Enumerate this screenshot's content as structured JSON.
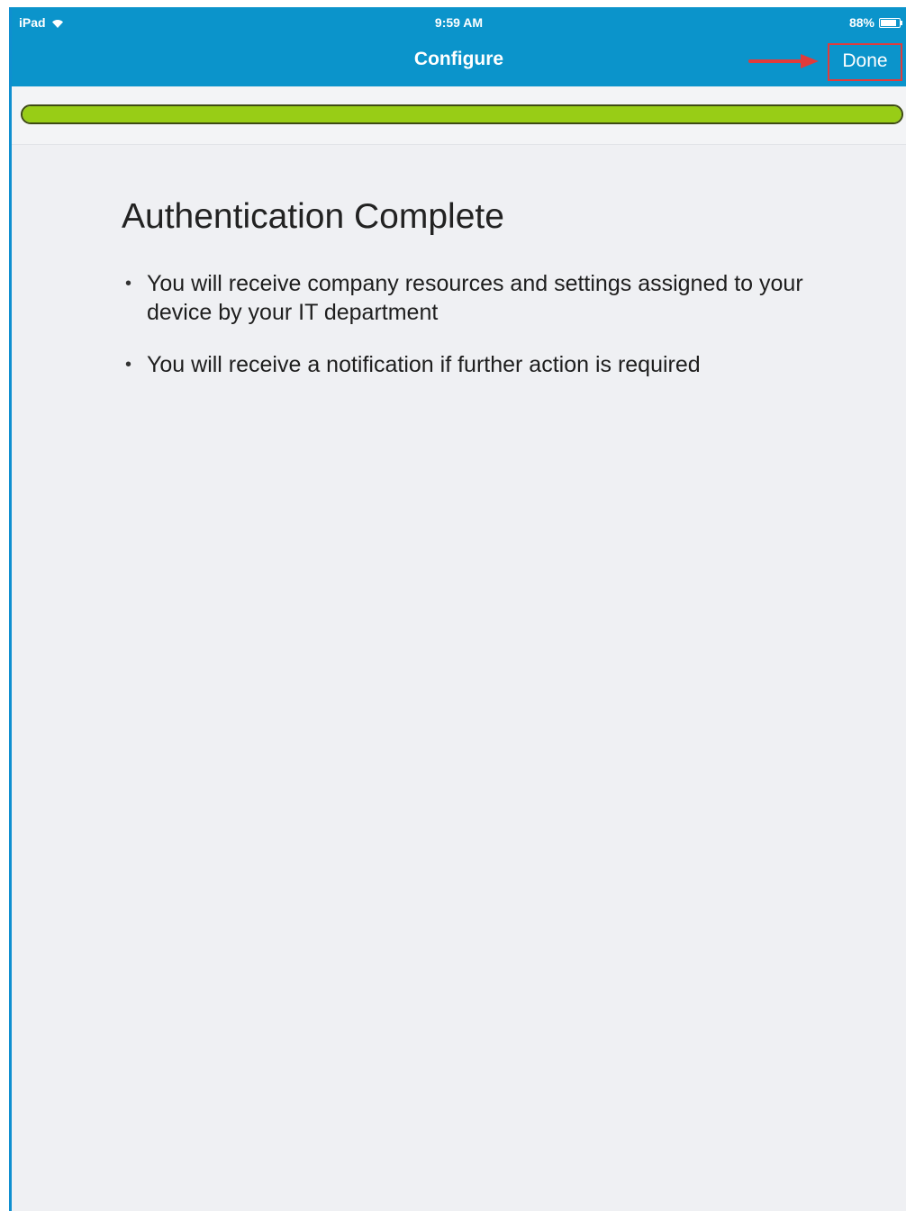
{
  "status_bar": {
    "device": "iPad",
    "time": "9:59 AM",
    "battery": "88%"
  },
  "nav": {
    "title": "Configure",
    "done_label": "Done"
  },
  "progress": {
    "fraction": 1.0,
    "color": "#98cd16"
  },
  "main": {
    "heading": "Authentication Complete",
    "bullets": [
      "You will receive company resources and settings assigned to your device by your IT department",
      "You will receive a notification if further action is required"
    ]
  },
  "colors": {
    "nav_background": "#0b94cb",
    "annotation": "#e23b3b",
    "page_background": "#eff0f3"
  }
}
